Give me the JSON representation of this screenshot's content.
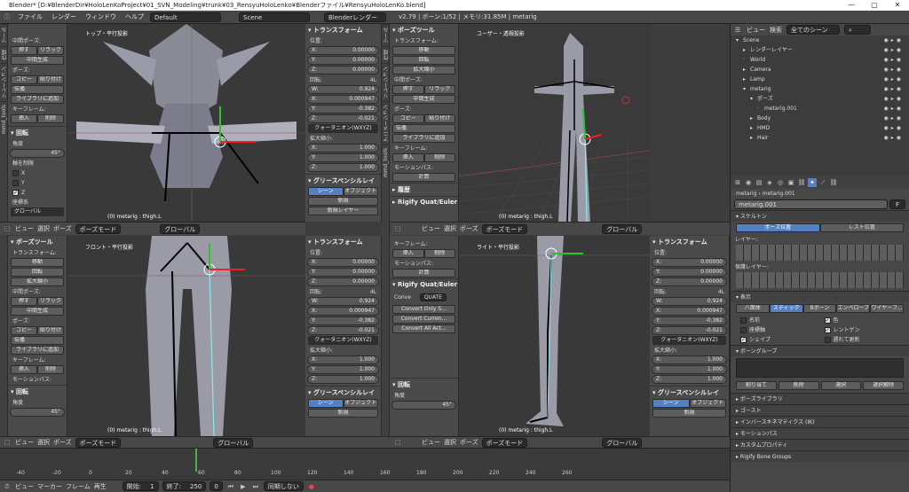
{
  "titlebar": {
    "text": "Blender* [D:¥BlenderDir¥HoloLenKoProject¥01_SVN_Modeling¥trunk¥03_RensyuHoloLenko¥Blenderファイル¥RensyuHoloLenKo.blend]",
    "minimize": "—",
    "maximize": "▢",
    "close": "✕"
  },
  "topbar": {
    "menus": [
      "ファイル",
      "レンダー",
      "ウィンドウ",
      "ヘルプ"
    ],
    "layout": "Default",
    "scene": "Scene",
    "engine": "Blenderレンダー",
    "info": "v2.79 | ボーン:1/52 | メモリ:31.85M | metarig"
  },
  "left_tabs": [
    "ツール",
    "作成",
    "リレーション",
    "アニメーション",
    "物理演算",
    "グリースペンシル",
    "mmd_tools"
  ],
  "tool_upper": {
    "transform_header": "",
    "items": [
      {
        "type": "label",
        "text": "中間ポーズ:"
      },
      {
        "type": "row",
        "a": "押す",
        "b": "リラック"
      },
      {
        "type": "btn",
        "text": "中間生成"
      },
      {
        "type": "label",
        "text": "ポーズ:"
      },
      {
        "type": "row",
        "a": "コピー",
        "b": "貼り付け"
      },
      {
        "type": "btnarrow",
        "text": "伝播"
      },
      {
        "type": "btn",
        "text": "ライブラリに追加"
      },
      {
        "type": "label",
        "text": "キーフレーム:"
      },
      {
        "type": "row",
        "a": "挿入",
        "b": "削除"
      }
    ],
    "rot_header": "▾ 回転",
    "angle_label": "角度",
    "angle_value": "45°",
    "axis_label": "軸を制限",
    "axes": [
      {
        "name": "X",
        "on": false
      },
      {
        "name": "Y",
        "on": false
      },
      {
        "name": "Z",
        "on": true
      }
    ],
    "coord_label": "座標系",
    "coord_value": "グローバル"
  },
  "tool_lower": {
    "pose_tool": "▾ ポーズツール",
    "transform": "トランスフォーム:",
    "move": "移動",
    "rotate": "回転",
    "scale": "拡大縮小",
    "mid_pose": "中間ポーズ:",
    "push": "押す",
    "relax": "リラック",
    "breakdown": "中間生成",
    "pose": "ポーズ:",
    "copy": "コピー",
    "paste": "貼り付け",
    "propagate": "伝播",
    "library": "ライブラリに追加",
    "keyframe": "キーフレーム:",
    "insert": "挿入",
    "delete": "削除",
    "motion_path": "モーションパス:",
    "rot_header": "▾ 回転",
    "angle_label": "角度",
    "angle_value": "45°"
  },
  "viewports": {
    "top_left": {
      "title": "トップ・平行投影",
      "object": "(0) metarig : thigh.L"
    },
    "top_right": {
      "title": "ユーザー・透視投影",
      "object": "(0) metarig : thigh.L"
    },
    "bottom_left": {
      "title": "フロント・平行投影",
      "object": "(0) metarig : thigh.L"
    },
    "bottom_right": {
      "title": "ライト・平行投影",
      "object": "(0) metarig : thigh.L"
    },
    "header": {
      "view": "ビュー",
      "select": "選択",
      "pose": "ポーズ",
      "mode": "ポーズモード",
      "orient": "グローバル"
    }
  },
  "npanel": {
    "transform": "▾ トランスフォーム",
    "location": "位置:",
    "loc": [
      {
        "axis": "X:",
        "value": "0.00000"
      },
      {
        "axis": "Y:",
        "value": "0.00000"
      },
      {
        "axis": "Z:",
        "value": "0.00000"
      }
    ],
    "rotation": "回転:",
    "rot_mode_tag": "4L",
    "rot": [
      {
        "axis": "W:",
        "value": "0.924"
      },
      {
        "axis": "X:",
        "value": "0.000947"
      },
      {
        "axis": "Y:",
        "value": "-0.382"
      },
      {
        "axis": "Z:",
        "value": "-0.021"
      }
    ],
    "rot_mode": "クォータニオン(WXYZ)",
    "scale": "拡大縮小:",
    "scl": [
      {
        "axis": "X:",
        "value": "1.000"
      },
      {
        "axis": "Y:",
        "value": "1.000"
      },
      {
        "axis": "Z:",
        "value": "1.000"
      }
    ],
    "grease": "▾ グリースペンシルレイ",
    "scene_btn": "シーン",
    "object_btn": "オブジェクト",
    "new_btn": "新規",
    "new_layer": "新規レイヤー"
  },
  "tool_right_upper": {
    "header": "▾ ポーズツール",
    "transform": "トランスフォーム:",
    "move": "移動",
    "rotate": "回転",
    "scale": "拡大縮小",
    "mid_pose": "中間ポーズ:",
    "push": "押す",
    "relax": "リラック",
    "breakdown": "中間生成",
    "pose": "ポーズ:",
    "copy": "コピー",
    "paste": "貼り付け",
    "propagate": "伝播",
    "library": "ライブラリに追加",
    "keyframe": "キーフレーム:",
    "insert": "挿入",
    "delete": "削除",
    "motion_path": "モーションパス:",
    "calc": "計算",
    "history": "▸ 履歴",
    "rigify": "▸ Rigify Quat/Euler"
  },
  "tool_right_lower": {
    "keyframe": "キーフレーム:",
    "insert": "挿入",
    "delete": "削除",
    "motion_path": "モーションパス:",
    "calc": "計算",
    "rigify": "▾ Rigify Quat/Euler",
    "convert_label": "Conve",
    "convert_value": "QUATE",
    "convert_only": "Convert Only S...",
    "convert_current": "Convert Curren...",
    "convert_all": "Convert All Act...",
    "rot_header": "▾ 回転",
    "angle_label": "角度",
    "angle_value": "45°"
  },
  "outliner": {
    "view": "ビュー",
    "search": "検索",
    "filter": "全てのシーン",
    "rows": [
      {
        "indent": 0,
        "icon": "▾",
        "name": "Scene"
      },
      {
        "indent": 1,
        "icon": "▸",
        "name": "レンダーレイヤー"
      },
      {
        "indent": 1,
        "icon": "·",
        "name": "World"
      },
      {
        "indent": 1,
        "icon": "▸",
        "name": "Camera"
      },
      {
        "indent": 1,
        "icon": "▸",
        "name": "Lamp"
      },
      {
        "indent": 1,
        "icon": "▾",
        "name": "metarig"
      },
      {
        "indent": 2,
        "icon": "▾",
        "name": "ポーズ"
      },
      {
        "indent": 3,
        "icon": "·",
        "name": "metarig.001"
      },
      {
        "indent": 2,
        "icon": "▸",
        "name": "Body"
      },
      {
        "indent": 2,
        "icon": "▸",
        "name": "HMD"
      },
      {
        "indent": 2,
        "icon": "▸",
        "name": "Hair"
      }
    ]
  },
  "properties": {
    "breadcrumb_obj": "metarig",
    "breadcrumb_sub": "metarig.001",
    "name_field": "metarig.001",
    "name_tag": "F",
    "skeleton": "▾ スケルトン",
    "pose_pos": "ポーズ位置",
    "rest_pos": "レスト位置",
    "layers": "レイヤー:",
    "protect_layers": "保護レイヤー:",
    "display": "▾ 表示",
    "display_modes": [
      "八面体",
      "スティック",
      "Bボーン",
      "エンベロープ",
      "ワイヤーフ..."
    ],
    "options": [
      {
        "name": "名前",
        "on": false
      },
      {
        "name": "色",
        "on": true
      },
      {
        "name": "座標軸",
        "on": false
      },
      {
        "name": "レントゲン",
        "on": true
      },
      {
        "name": "シェイプ",
        "on": true
      },
      {
        "name": "遅れて更新",
        "on": false
      }
    ],
    "bone_groups": "▾ ボーングループ",
    "assign": "割り当て",
    "remove": "削除",
    "select": "選択",
    "deselect": "選択解除",
    "collapsed": [
      "▸ ポーズライブラリ",
      "▸ ゴースト",
      "▸ インバースキネマティクス (IK)",
      "▸ モーションパス",
      "▸ カスタムプロパティ",
      "▸ Rigify Bone Groups"
    ]
  },
  "timeline": {
    "ticks": [
      "-40",
      "-20",
      "0",
      "20",
      "40",
      "60",
      "80",
      "100",
      "120",
      "140",
      "160",
      "180",
      "200",
      "220",
      "240",
      "260"
    ],
    "view": "ビュー",
    "marker": "マーカー",
    "frame": "フレーム",
    "play": "再生",
    "start_label": "開始:",
    "start": "1",
    "end_label": "終了:",
    "end": "250",
    "current": "0",
    "sync": "同期しない"
  }
}
